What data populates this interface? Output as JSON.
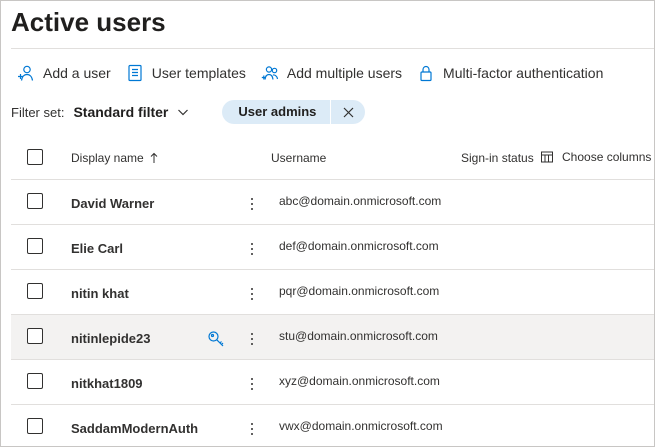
{
  "page": {
    "title": "Active users"
  },
  "toolbar": {
    "add_user": "Add a user",
    "user_templates": "User templates",
    "add_multiple": "Add multiple users",
    "mfa": "Multi-factor authentication"
  },
  "filter": {
    "label": "Filter set:",
    "value": "Standard filter",
    "pill": "User admins"
  },
  "table": {
    "columns": {
      "display_name": "Display name",
      "username": "Username",
      "sign_in": "Sign-in status",
      "choose_columns": "Choose columns"
    },
    "rows": [
      {
        "name": "David Warner",
        "username": "abc@domain.onmicrosoft.com"
      },
      {
        "name": "Elie Carl",
        "username": "def@domain.onmicrosoft.com"
      },
      {
        "name": "nitin khat",
        "username": "pqr@domain.onmicrosoft.com"
      },
      {
        "name": "nitinlepide23",
        "username": "stu@domain.onmicrosoft.com",
        "selected": true
      },
      {
        "name": "nitkhat1809",
        "username": "xyz@domain.onmicrosoft.com"
      },
      {
        "name": "SaddamModernAuth",
        "username": "vwx@domain.onmicrosoft.com"
      }
    ]
  },
  "colors": {
    "accent": "#0078d4",
    "pill_bg": "#dcebf7",
    "selected_row": "#f3f2f1"
  },
  "icons": [
    "add-user-icon",
    "user-templates-icon",
    "add-multiple-users-icon",
    "lock-icon",
    "chevron-down-icon",
    "close-icon",
    "sort-ascending-icon",
    "choose-columns-icon",
    "more-options-icon",
    "reset-password-icon"
  ]
}
